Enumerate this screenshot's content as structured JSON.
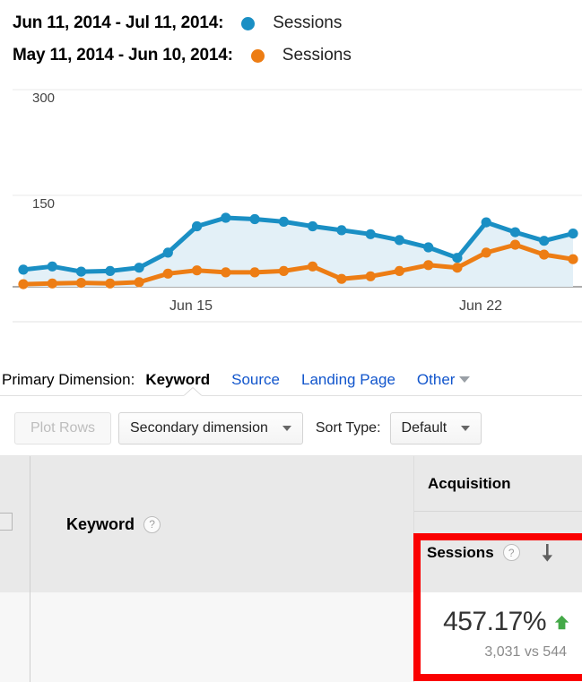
{
  "legend": {
    "rows": [
      {
        "range": "Jun 11, 2014 - Jul 11, 2014:",
        "metric": "Sessions",
        "color": "#1A8FC4"
      },
      {
        "range": "May 11, 2014 - Jun 10, 2014:",
        "metric": "Sessions",
        "color": "#ED7D14"
      }
    ]
  },
  "chart_data": {
    "type": "line",
    "title": "",
    "xlabel": "",
    "ylabel": "",
    "ylim": [
      0,
      300
    ],
    "yticks": [
      150,
      300
    ],
    "ytick_labels": [
      "150",
      "300"
    ],
    "xticks": [
      "Jun 15",
      "Jun 22"
    ],
    "xtick_positions": [
      4,
      11
    ],
    "grid": true,
    "legend_position": "top",
    "x": [
      0,
      1,
      2,
      3,
      4,
      5,
      6,
      7,
      8,
      9,
      10,
      11,
      12,
      13,
      14,
      15,
      16,
      17,
      18,
      19
    ],
    "series": [
      {
        "name": "Sessions",
        "period": "Jun 11, 2014 - Jul 11, 2014",
        "color": "#1A8FC4",
        "fill": "#E3F0F7",
        "values": [
          26,
          31,
          23,
          24,
          29,
          52,
          92,
          105,
          103,
          99,
          92,
          86,
          80,
          71,
          60,
          44,
          98,
          83,
          70,
          81
        ]
      },
      {
        "name": "Sessions",
        "period": "May 11, 2014 - Jun 10, 2014",
        "color": "#ED7D14",
        "fill": "none",
        "values": [
          4,
          5,
          6,
          5,
          7,
          20,
          25,
          22,
          22,
          24,
          31,
          12,
          16,
          24,
          33,
          29,
          52,
          64,
          49,
          42
        ]
      }
    ]
  },
  "primary_dimension": {
    "label": "Primary Dimension:",
    "items": [
      {
        "label": "Keyword",
        "active": true
      },
      {
        "label": "Source",
        "active": false
      },
      {
        "label": "Landing Page",
        "active": false
      },
      {
        "label": "Other",
        "active": false,
        "has_caret": true
      }
    ]
  },
  "toolbar": {
    "plot_rows_label": "Plot Rows",
    "plot_rows_disabled": true,
    "secondary_dimension_label": "Secondary dimension",
    "sort_type_label": "Sort Type:",
    "sort_type_value": "Default"
  },
  "table": {
    "group_header": "Acquisition",
    "dimension_column": "Keyword",
    "help_glyph": "?",
    "metric_column": "Sessions",
    "sort_direction": "descending",
    "metric_value": "457.17%",
    "metric_delta_direction": "up",
    "metric_delta_color": "#44A948",
    "metric_compare": "3,031 vs 544"
  },
  "highlight": {
    "color": "#FA0000"
  }
}
